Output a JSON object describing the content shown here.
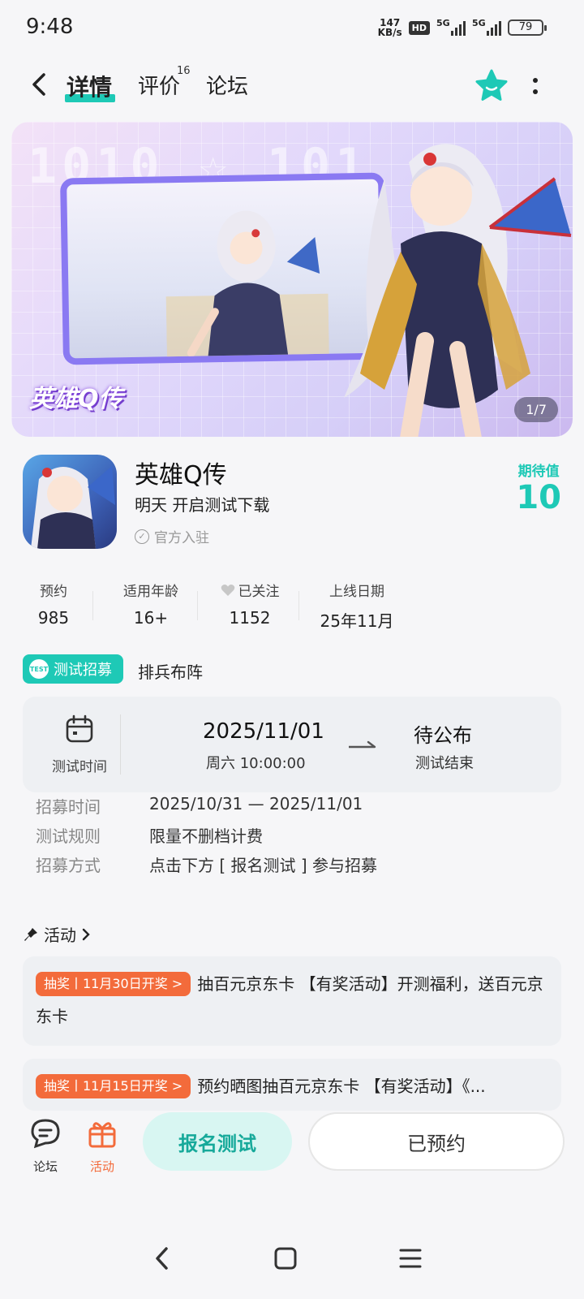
{
  "status_bar": {
    "time": "9:48",
    "net_speed_value": "147",
    "net_speed_unit": "KB/s",
    "hd_label": "HD",
    "network_1": "5G",
    "network_2": "5G",
    "battery": "79"
  },
  "nav": {
    "tabs": [
      {
        "label": "详情",
        "active": true
      },
      {
        "label": "评价",
        "badge": "16"
      },
      {
        "label": "论坛"
      }
    ],
    "icons": [
      "back-arrow-icon",
      "star-favorite-icon",
      "more-vertical-icon"
    ],
    "accent_color": "#1ec9b6"
  },
  "banner": {
    "logo_text": "英雄Q传",
    "counter": "1/7"
  },
  "game": {
    "name": "英雄Q传",
    "subtitle": "明天 开启测试下载",
    "official_label": "官方入驻",
    "expect_label": "期待值",
    "expect_value": "10"
  },
  "stats": [
    {
      "label": "预约",
      "value": "985"
    },
    {
      "label": "适用年龄",
      "value": "16+"
    },
    {
      "label": "已关注",
      "value": "1152",
      "icon": "heart-icon"
    },
    {
      "label": "上线日期",
      "value": "25年11月"
    }
  ],
  "test": {
    "tag_label": "测试招募",
    "lineup_label": "排兵布阵",
    "time_label": "测试时间",
    "start_date": "2025/11/01",
    "start_time": "周六  10:00:00",
    "end_state": "待公布",
    "end_label": "测试结束"
  },
  "info": [
    {
      "key": "招募时间",
      "value": "2025/10/31 — 2025/11/01"
    },
    {
      "key": "测试规则",
      "value": "限量不删档计费"
    },
    {
      "key": "招募方式",
      "value": "点击下方 [ 报名测试 ] 参与招募"
    }
  ],
  "activities": {
    "header": "活动",
    "items": [
      {
        "badge": "抽奖丨11月30日开奖 >",
        "text": "抽百元京东卡 【有奖活动】开测福利，送百元京东卡"
      },
      {
        "badge": "抽奖丨11月15日开奖 >",
        "text": "预约晒图抽百元京东卡 【有奖活动】《..."
      }
    ],
    "badge_color": "#f36b3b"
  },
  "bottom_bar": {
    "forum_label": "论坛",
    "activity_label": "活动",
    "signup_label": "报名测试",
    "reserved_label": "已预约"
  }
}
